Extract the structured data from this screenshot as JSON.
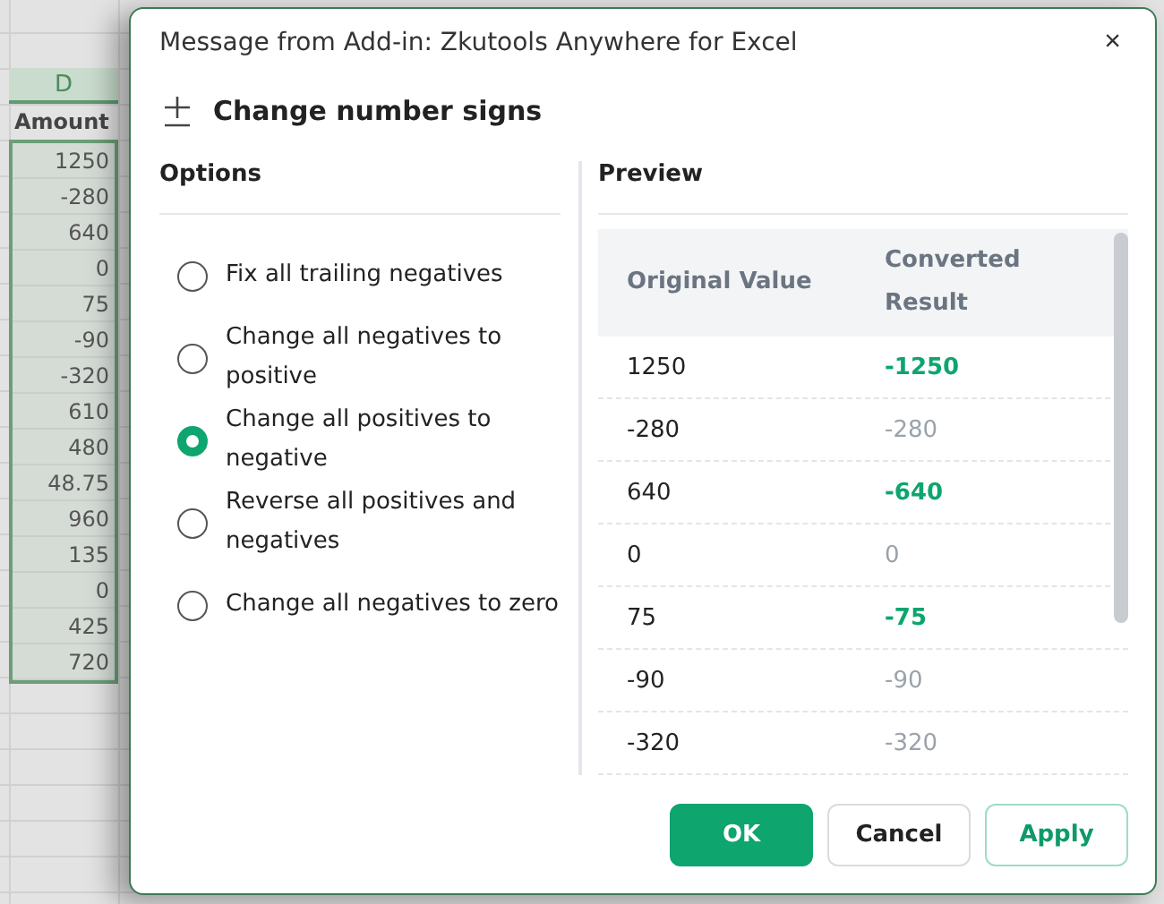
{
  "sheet": {
    "column": "D",
    "header": "Amount",
    "cells": [
      "1250",
      "-280",
      "640",
      "0",
      "75",
      "-90",
      "-320",
      "610",
      "480",
      "48.75",
      "960",
      "135",
      "0",
      "425",
      "720"
    ]
  },
  "dialog": {
    "title": "Message from Add-in: Zkutools Anywhere for Excel",
    "close": "×",
    "heading": "Change number signs",
    "options_title": "Options",
    "options": [
      {
        "label": "Fix all trailing negatives",
        "selected": false
      },
      {
        "label": "Change all negatives to positive",
        "selected": false
      },
      {
        "label": "Change all positives to negative",
        "selected": true
      },
      {
        "label": "Reverse all positives and negatives",
        "selected": false
      },
      {
        "label": "Change all negatives to zero",
        "selected": false
      }
    ],
    "preview_title": "Preview",
    "columns": [
      "Original Value",
      "Converted Result"
    ],
    "rows": [
      {
        "original": "1250",
        "result": "-1250",
        "changed": true
      },
      {
        "original": "-280",
        "result": "-280",
        "changed": false
      },
      {
        "original": "640",
        "result": "-640",
        "changed": true
      },
      {
        "original": "0",
        "result": "0",
        "changed": false
      },
      {
        "original": "75",
        "result": "-75",
        "changed": true
      },
      {
        "original": "-90",
        "result": "-90",
        "changed": false
      },
      {
        "original": "-320",
        "result": "-320",
        "changed": false
      }
    ],
    "buttons": [
      {
        "label": "OK",
        "kind": "primary"
      },
      {
        "label": "Cancel",
        "kind": "plain"
      },
      {
        "label": "Apply",
        "kind": "outline"
      }
    ]
  }
}
